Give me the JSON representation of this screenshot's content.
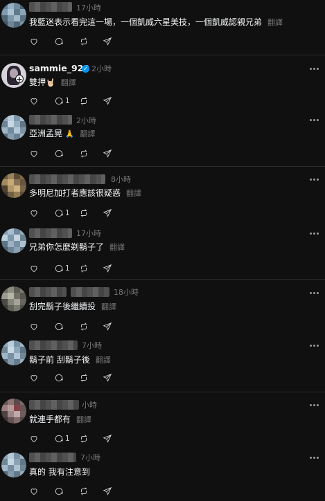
{
  "translate_label": "翻譯",
  "posts": [
    {
      "time": "17小時",
      "text": "我藍迷表示看完這一場，一個凱威六星美技，一個凱威認親兄弟",
      "reply_count": ""
    },
    {
      "username": "sammie_923",
      "time": "2小時",
      "text": "雙押",
      "emoji": "🤘🏻",
      "reply_count": "1"
    },
    {
      "time": "2小時",
      "text": "亞洲孟晃",
      "emoji": "🙏",
      "reply_count": ""
    },
    {
      "time": "8小時",
      "text": "多明尼加打者應該很疑惑",
      "reply_count": "1"
    },
    {
      "time": "17小時",
      "text": "兄弟你怎麼剃鬍子了",
      "reply_count": "1"
    },
    {
      "time": "18小時",
      "text": "刮完鬍子後繼續投",
      "reply_count": ""
    },
    {
      "time": "7小時",
      "text": "鬍子前 刮鬍子後",
      "reply_count": ""
    },
    {
      "time": "小時",
      "text": "就連手都有",
      "reply_count": "1"
    },
    {
      "time": "7小時",
      "text": "真的 我有注意到",
      "reply_count": ""
    }
  ],
  "colors": {
    "background": "#101010",
    "text": "#f3f5f7",
    "muted": "#777777",
    "verified": "#0095f6"
  }
}
